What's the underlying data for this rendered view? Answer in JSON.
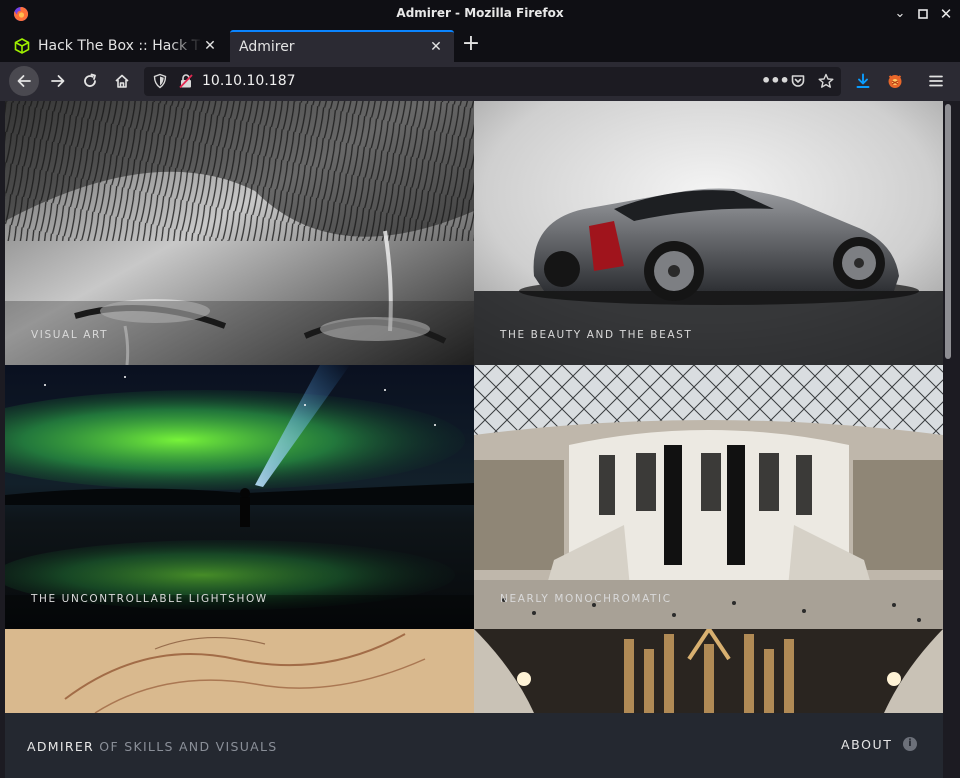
{
  "window": {
    "title": "Admirer - Mozilla Firefox"
  },
  "tabs": [
    {
      "label": "Hack The Box :: Hack The Box",
      "active": false
    },
    {
      "label": "Admirer",
      "active": true
    }
  ],
  "navbar": {
    "url": "10.10.10.187"
  },
  "gallery": [
    {
      "caption": "VISUAL ART"
    },
    {
      "caption": "THE BEAUTY AND THE BEAST"
    },
    {
      "caption": "THE UNCONTROLLABLE LIGHTSHOW"
    },
    {
      "caption": "NEARLY MONOCHROMATIC"
    },
    {
      "caption": ""
    },
    {
      "caption": ""
    }
  ],
  "footer": {
    "brand": "ADMIRER",
    "brand_sub": " OF SKILLS AND VISUALS",
    "about": "ABOUT",
    "info_icon": "i"
  },
  "colors": {
    "accent": "#0a84ff",
    "chrome_dark": "#0f0f14",
    "toolbar": "#2b2a33",
    "footer_bg": "#242830"
  }
}
